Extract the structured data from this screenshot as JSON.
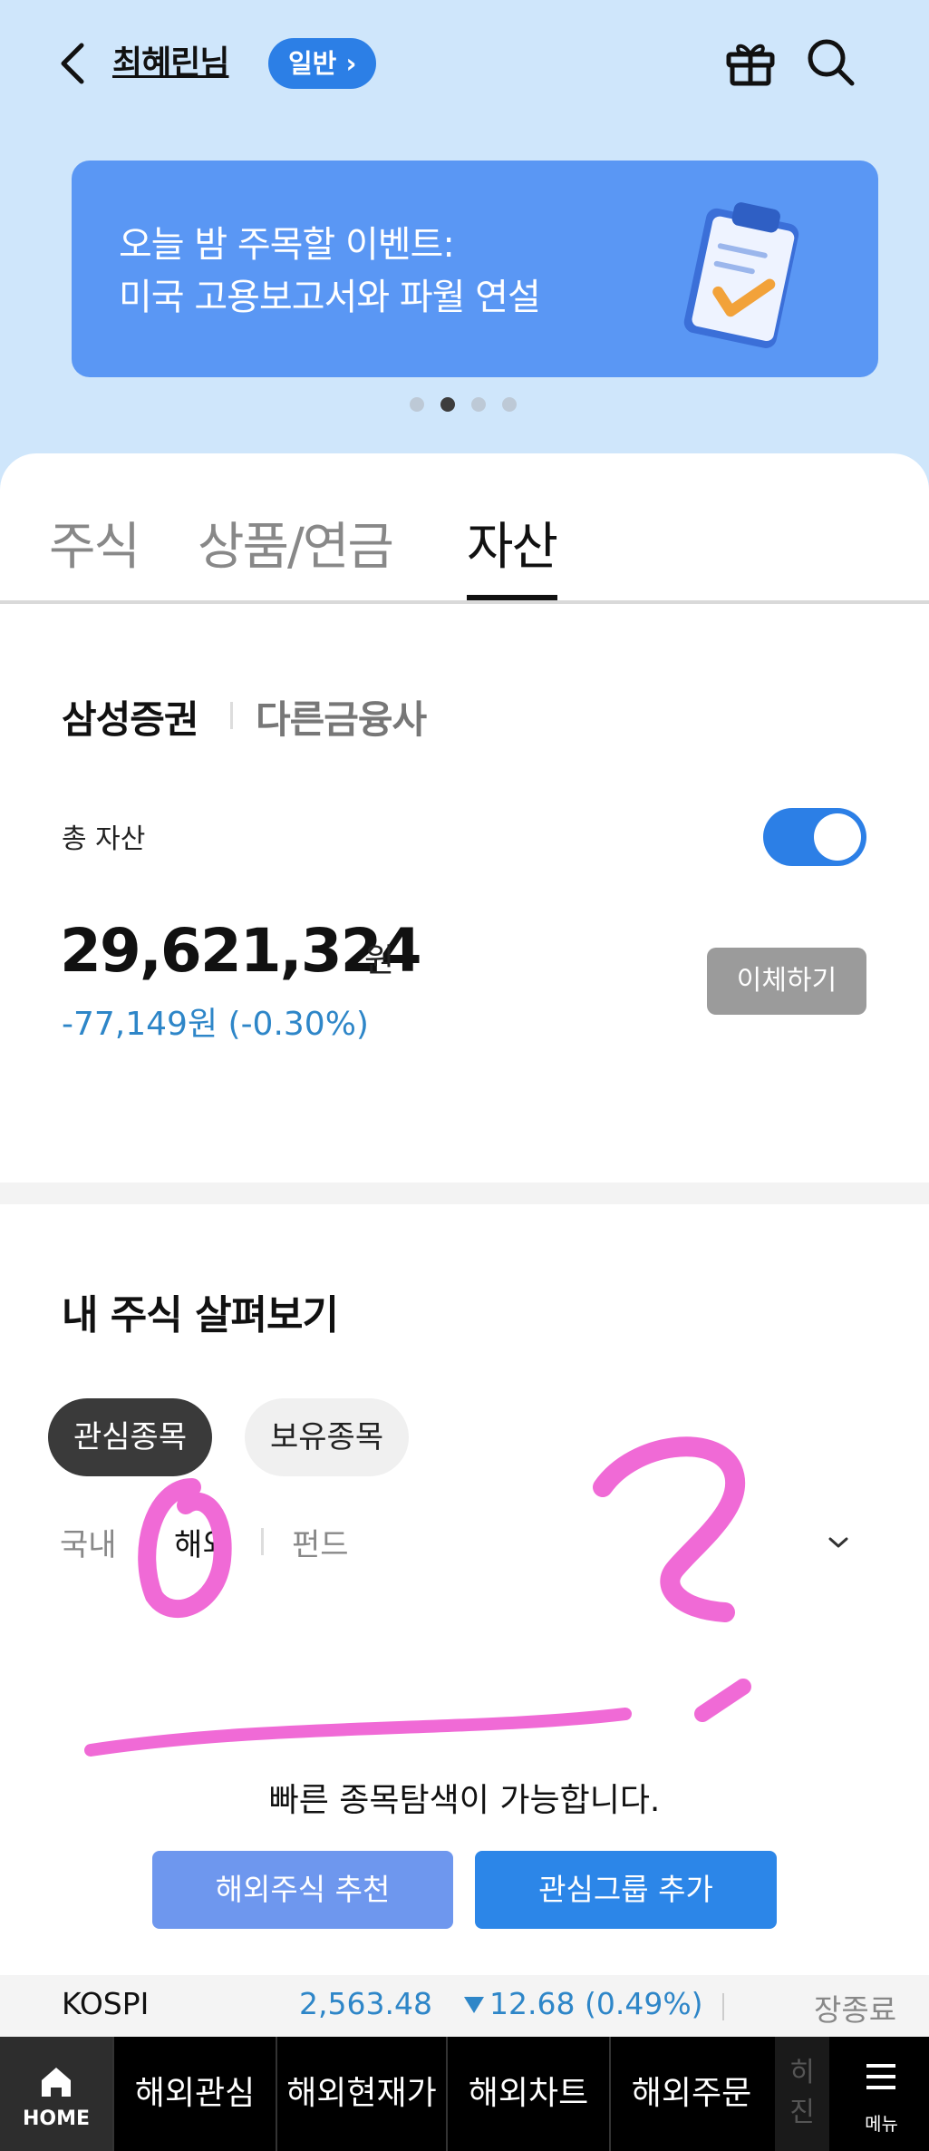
{
  "header": {
    "username": "최혜린님",
    "badge": "일반 ›"
  },
  "banner": {
    "line1": "오늘 밤 주목할 이벤트:",
    "line2": "미국 고용보고서와 파월 연설",
    "page_index": 2,
    "page_count": 4
  },
  "tabs": [
    {
      "label": "주식"
    },
    {
      "label": "상품/연금"
    },
    {
      "label": "자산"
    }
  ],
  "active_tab": "자산",
  "assets": {
    "segment_active": "삼성증권",
    "segment_other": "다른금융사",
    "total_label": "총 자산",
    "toggle_on": true,
    "amount": "29,621,324",
    "unit": "원",
    "change": "-77,149원 (-0.30%)",
    "transfer_label": "이체하기"
  },
  "my_stocks": {
    "title": "내 주식 살펴보기",
    "chips": [
      "관심종목",
      "보유종목"
    ],
    "subtabs": [
      "국내",
      "해외",
      "펀드"
    ],
    "subtab_selected": "해외",
    "empty_text": "빠른 종목탐색이 가능합니다.",
    "buttons": {
      "recommend": "해외주식 추천",
      "add_group": "관심그룹 추가"
    }
  },
  "ticker": {
    "name": "KOSPI",
    "value": "2,563.48",
    "change": "12.68 (0.49%)",
    "status": "장종료"
  },
  "bottom_nav": {
    "home": "HOME",
    "items": [
      "해외관심",
      "해외현재가",
      "해외차트",
      "해외주문"
    ],
    "peek": "히 진",
    "menu": "메뉴"
  },
  "colors": {
    "accent": "#2c7fe6",
    "banner": "#5a97f4",
    "down": "#2e86c8",
    "top_bg": "#cfe6fb",
    "doodle": "#f06ad6"
  }
}
